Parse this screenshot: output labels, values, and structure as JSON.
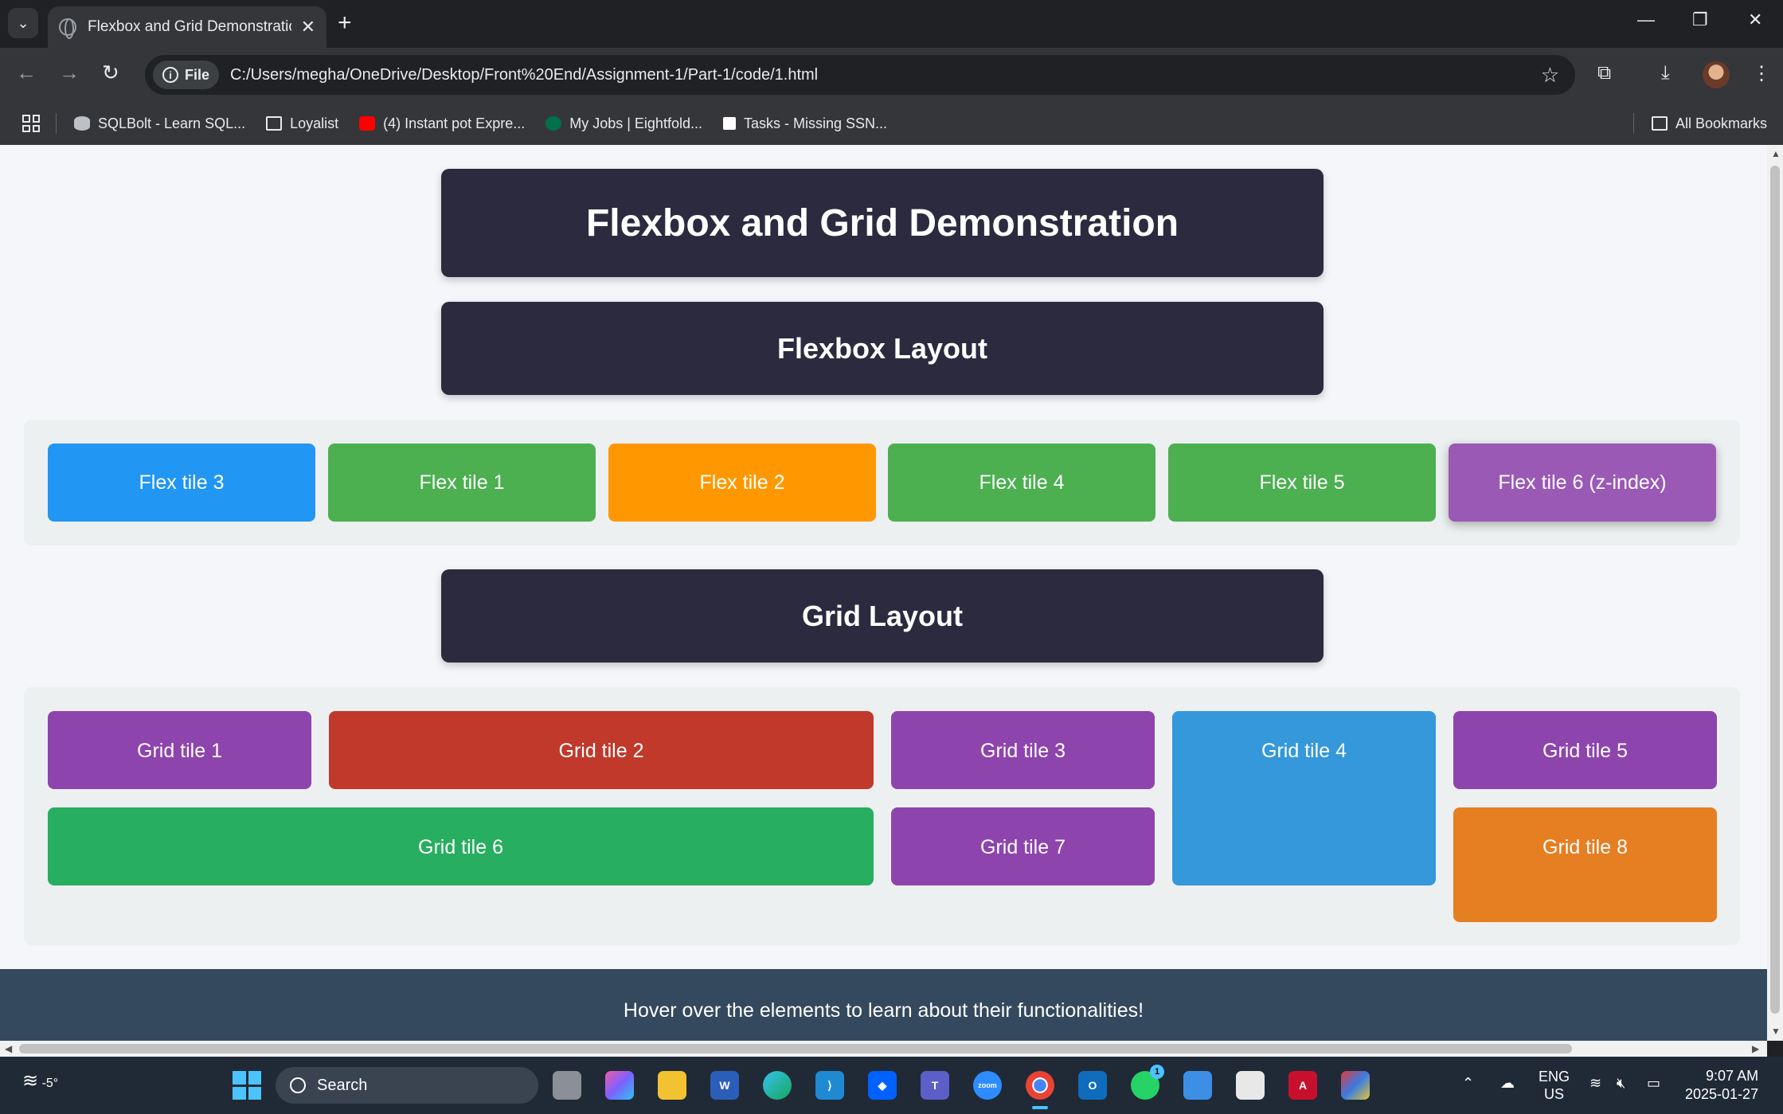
{
  "browser": {
    "tab_title": "Flexbox and Grid Demonstration",
    "url_chip": "File",
    "url": "C:/Users/megha/OneDrive/Desktop/Front%20End/Assignment-1/Part-1/code/1.html",
    "bookmarks": [
      "SQLBolt - Learn SQL...",
      "Loyalist",
      "(4) Instant pot Expre...",
      "My Jobs | Eightfold...",
      "Tasks - Missing SSN..."
    ],
    "all_bookmarks": "All Bookmarks"
  },
  "page": {
    "title": "Flexbox and Grid Demonstration",
    "flex_heading": "Flexbox Layout",
    "flex_tiles": [
      {
        "label": "Flex tile 3",
        "color": "#2196f3"
      },
      {
        "label": "Flex tile 1",
        "color": "#4caf50"
      },
      {
        "label": "Flex tile 2",
        "color": "#ff9800"
      },
      {
        "label": "Flex tile 4",
        "color": "#4caf50"
      },
      {
        "label": "Flex tile 5",
        "color": "#4caf50"
      },
      {
        "label": "Flex tile 6 (z-index)",
        "color": "#9b59b6"
      }
    ],
    "grid_heading": "Grid Layout",
    "grid_tiles": [
      {
        "label": "Grid tile 1",
        "color": "#8e44ad"
      },
      {
        "label": "Grid tile 2",
        "color": "#c0392b"
      },
      {
        "label": "Grid tile 3",
        "color": "#8e44ad"
      },
      {
        "label": "Grid tile 4",
        "color": "#3498db"
      },
      {
        "label": "Grid tile 5",
        "color": "#8e44ad"
      },
      {
        "label": "Grid tile 6",
        "color": "#27ae60"
      },
      {
        "label": "Grid tile 7",
        "color": "#8e44ad"
      },
      {
        "label": "Grid tile 8",
        "color": "#e67e22"
      }
    ],
    "footer": "Hover over the elements to learn about their functionalities!"
  },
  "taskbar": {
    "weather": "-5°",
    "search_placeholder": "Search",
    "language_line1": "ENG",
    "language_line2": "US",
    "time": "9:07 AM",
    "date": "2025-01-27",
    "whatsapp_badge": "1"
  }
}
